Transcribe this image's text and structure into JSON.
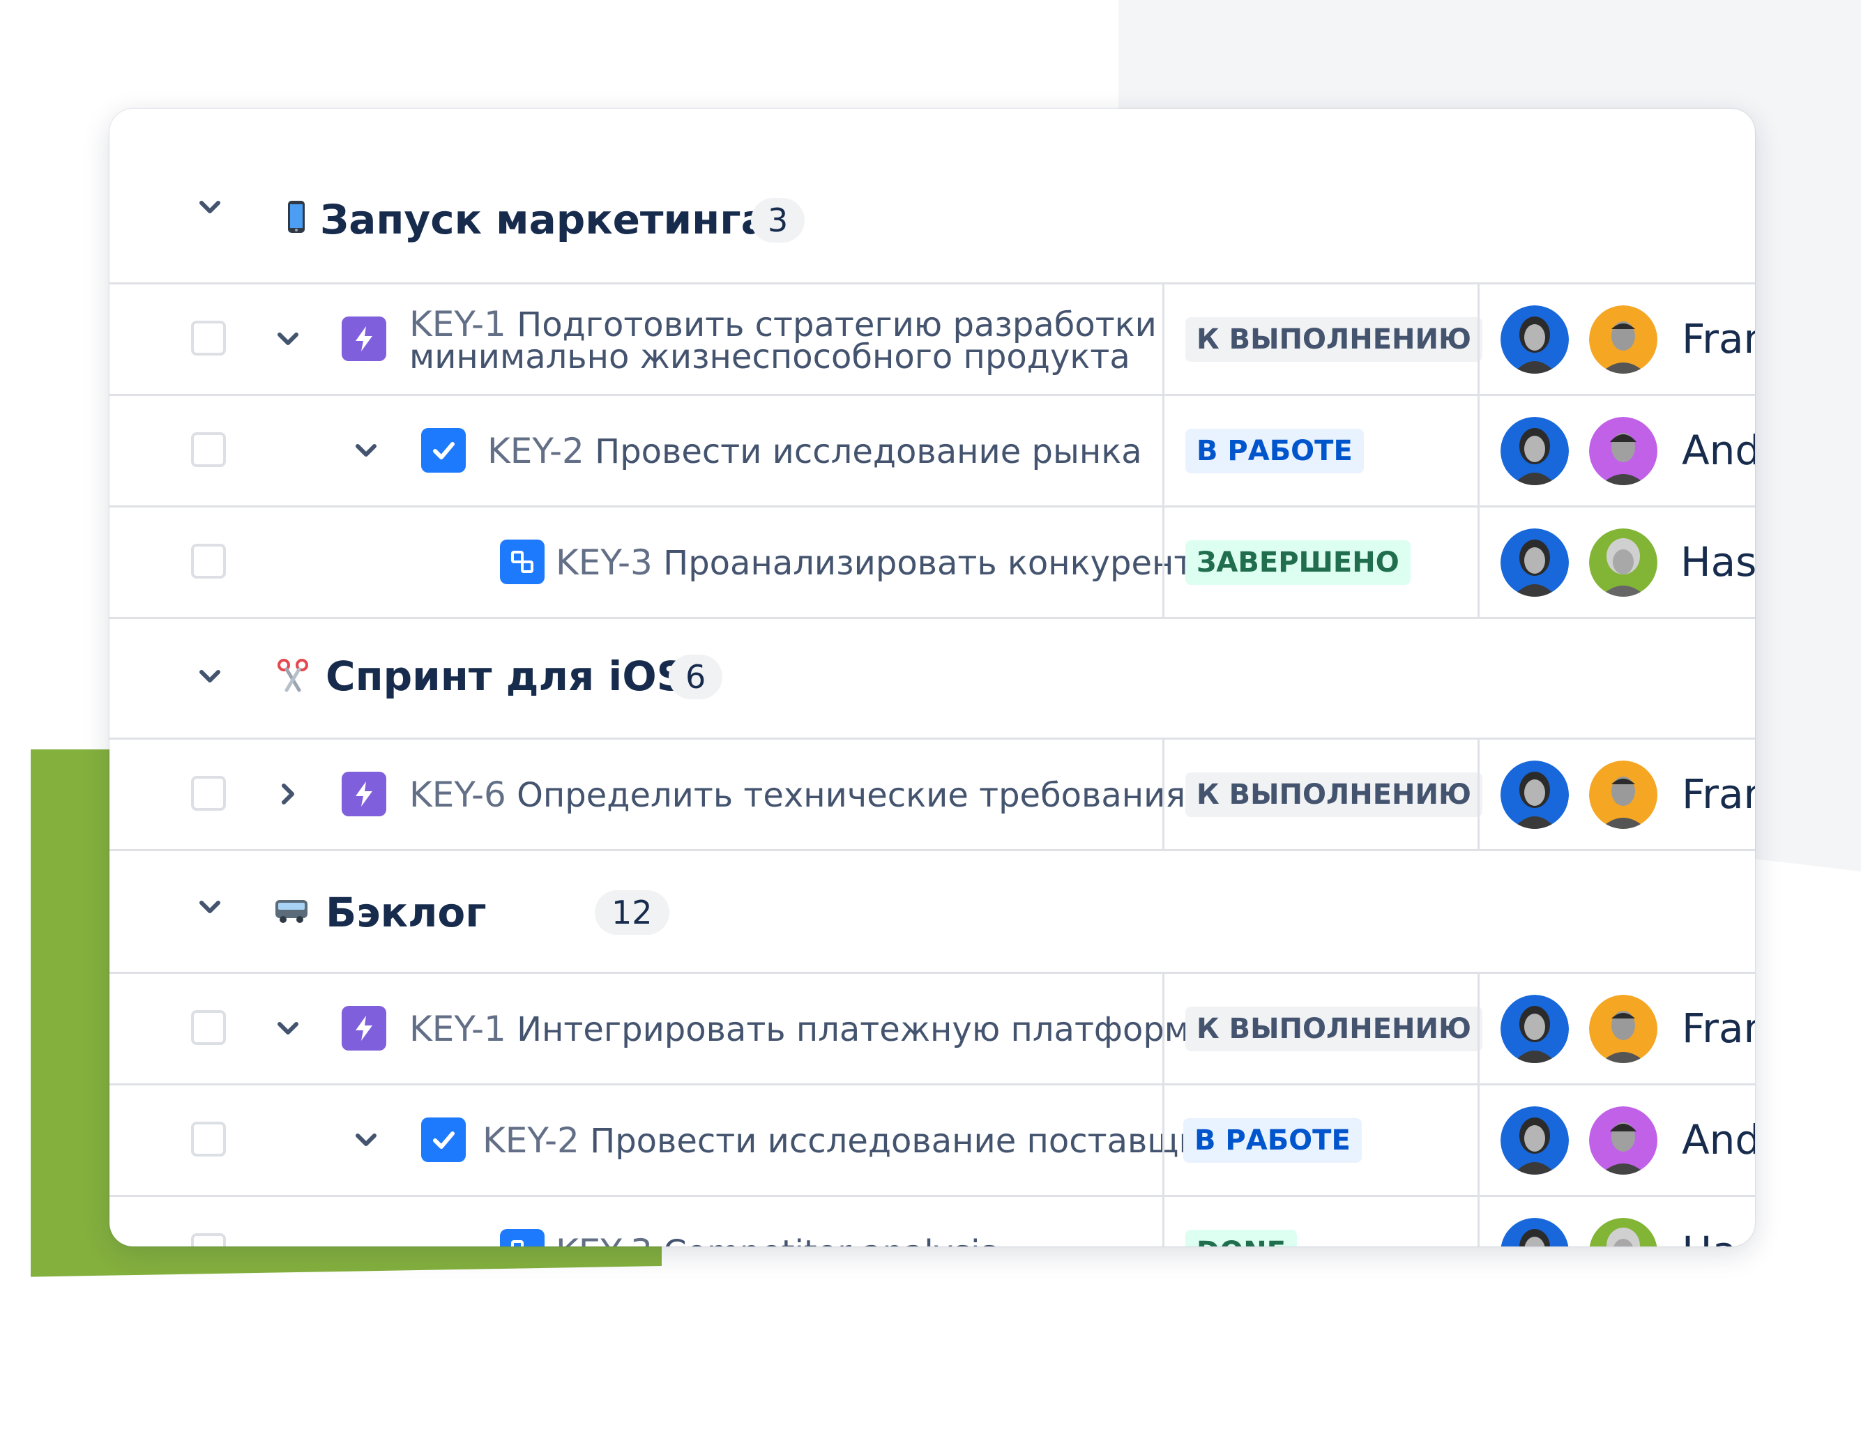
{
  "colors": {
    "accent_green": "#84b03e",
    "status_todo_bg": "#f1f2f4",
    "status_in_progress_bg": "#e9f2ff",
    "status_done_bg": "#dcfff1",
    "epic_purple": "#7f5fdc",
    "task_blue": "#1d7afc"
  },
  "groups": [
    {
      "emoji": "mobile-phone-icon",
      "title": "Запуск маркетинга",
      "count": "3",
      "rows": [
        {
          "key": "KEY-1",
          "title_line1": "Подготовить стратегию разработки",
          "title_line2": "минимально жизнеспособного продукта",
          "type": "lightning-icon",
          "status": "К ВЫПОЛНЕНИЮ",
          "assignee": "Fran"
        },
        {
          "key": "KEY-2",
          "title": "Провести исследование рынка",
          "type": "checkmark-icon",
          "status": "В РАБОТЕ",
          "assignee": "And"
        },
        {
          "key": "KEY-3",
          "title": "Проанализировать конкурентов",
          "type": "subtask-icon",
          "status": "ЗАВЕРШЕНО",
          "assignee": "Hass"
        }
      ]
    },
    {
      "emoji": "scissors-icon",
      "title": "Спринт для iOS",
      "count": "6",
      "rows": [
        {
          "key": "KEY-6",
          "title": "Определить технические требования",
          "type": "lightning-icon",
          "status": "К ВЫПОЛНЕНИЮ",
          "assignee": "Fran"
        }
      ]
    },
    {
      "emoji": "bus-icon",
      "title": "Бэклог",
      "count": "12",
      "rows": [
        {
          "key": "KEY-1",
          "title": "Интегрировать платежную платформу",
          "type": "lightning-icon",
          "status": "К ВЫПОЛНЕНИЮ",
          "assignee": "Fran"
        },
        {
          "key": "KEY-2",
          "title": "Провести исследование поставщиков",
          "type": "checkmark-icon",
          "status": "В РАБОТЕ",
          "assignee": "And"
        },
        {
          "key": "KEY-3",
          "title": "Competitor analysis",
          "type": "subtask-icon",
          "status": "DONE",
          "assignee": "Hass"
        }
      ]
    }
  ]
}
